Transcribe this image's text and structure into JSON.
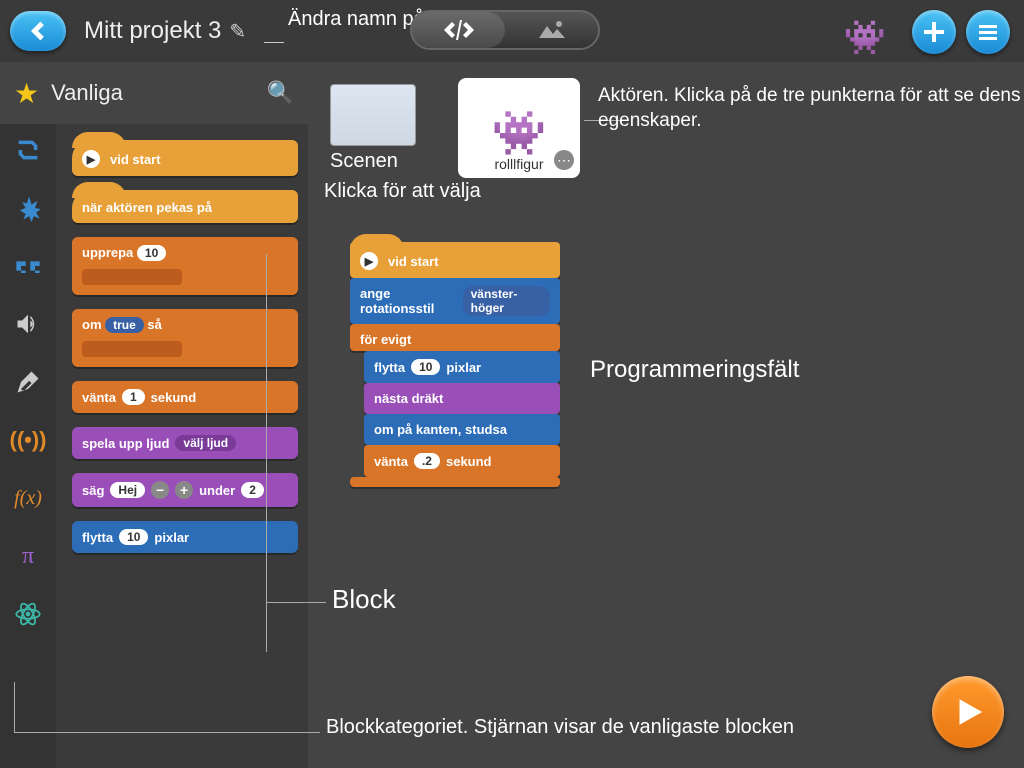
{
  "header": {
    "project_title": "Mitt projekt 3",
    "rename_hint": "Ändra namn på projektet"
  },
  "palette": {
    "title": "Vanliga"
  },
  "blocks_palette": {
    "vid_start": "vid start",
    "nar_aktoren": "när aktören pekas på",
    "upprepa": "upprepa",
    "upprepa_val": "10",
    "om": "om",
    "om_val": "true",
    "sa": "så",
    "vanta": "vänta",
    "vanta_val": "1",
    "sekund": "sekund",
    "spela": "spela upp ljud",
    "valj_ljud": "välj ljud",
    "sag": "säg",
    "sag_val": "Hej",
    "under": "under",
    "under_val": "2",
    "flytta": "flytta",
    "flytta_val": "10",
    "pixlar": "pixlar"
  },
  "script": {
    "vid_start": "vid start",
    "ange": "ange rotationsstil",
    "vanster": "vänster-höger",
    "for_evigt": "för evigt",
    "flytta": "flytta",
    "flytta_val": "10",
    "pixlar": "pixlar",
    "nasta": "nästa dräkt",
    "kanten": "om på kanten, studsa",
    "vanta": "vänta",
    "vanta_val": ".2",
    "sekund": "sekund"
  },
  "stage": {
    "scene_label": "Scenen",
    "scene_hint": "Klicka för att välja",
    "actor_name": "rolllfigur",
    "actor_hint": "Aktören. Klicka på de tre punkterna för att se dens egenskaper.",
    "programming_field": "Programmeringsfält",
    "block_label": "Block",
    "categories_hint": "Blockkategoriet. Stjärnan visar de vanligaste blocken"
  }
}
